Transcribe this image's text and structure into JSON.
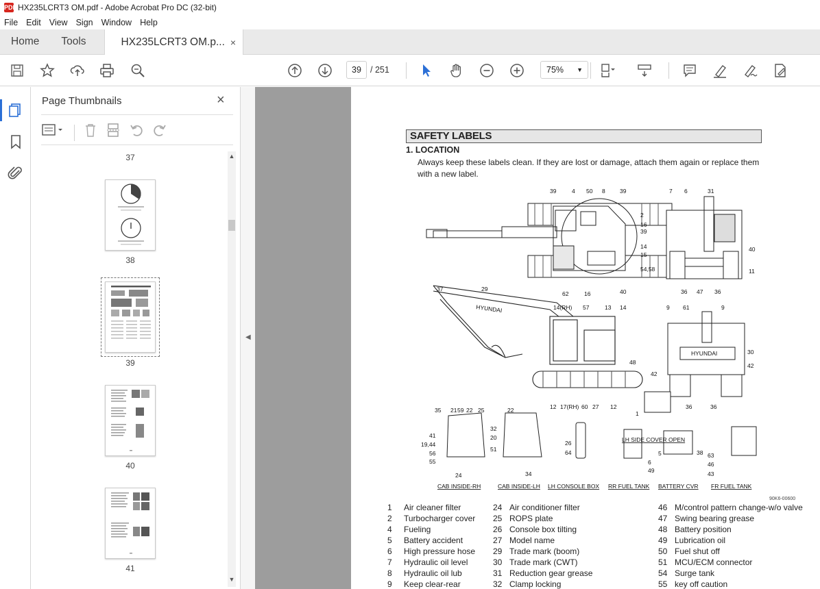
{
  "window": {
    "title": "HX235LCRT3 OM.pdf - Adobe Acrobat Pro DC (32-bit)",
    "app_icon": "PDF"
  },
  "menu": [
    "File",
    "Edit",
    "View",
    "Sign",
    "Window",
    "Help"
  ],
  "tabs": {
    "home": "Home",
    "tools": "Tools",
    "document": "HX235LCRT3 OM.p...",
    "close": "×"
  },
  "toolbar": {
    "current_page": "39",
    "page_total": "/ 251",
    "zoom": "75%",
    "icons": [
      "save-icon",
      "bookmark-star-icon",
      "upload-icon",
      "print-icon",
      "search-zoom-icon",
      "page-up-icon",
      "page-down-icon",
      "select-arrow-icon",
      "hand-icon",
      "zoom-out-icon",
      "zoom-in-icon",
      "fit-page-icon",
      "scroll-mode-icon",
      "comment-icon",
      "highlight-icon",
      "sign-icon",
      "edit-pdf-icon"
    ]
  },
  "thumb_panel": {
    "title": "Page Thumbnails",
    "close": "×",
    "pages": [
      {
        "label": "37"
      },
      {
        "label": "38"
      },
      {
        "label": "39",
        "selected": true
      },
      {
        "label": "40"
      },
      {
        "label": "41"
      }
    ]
  },
  "document": {
    "section_header": "SAFETY LABELS",
    "subsection": "1.  LOCATION",
    "intro": "Always keep these labels clean.  If they are lost or damage, attach them again or replace them with a new label.",
    "figure_code": "90K6-00600",
    "diagram_labels": {
      "top_view": [
        "39",
        "4",
        "50",
        "8",
        "39",
        "2",
        "16",
        "39",
        "14",
        "15",
        "54,58",
        "40",
        "16",
        "62"
      ],
      "rear_view": [
        "7",
        "6",
        "31",
        "40",
        "11",
        "36",
        "47",
        "36"
      ],
      "side_view": [
        "37",
        "29",
        "14(RH)",
        "57",
        "13",
        "14",
        "48",
        "12",
        "17(RH)",
        "60",
        "27",
        "12"
      ],
      "front_view": [
        "9",
        "61",
        "9",
        "30",
        "42",
        "42",
        "36",
        "36"
      ],
      "cab_rh": [
        "35",
        "21",
        "59",
        "22",
        "25",
        "41",
        "19,44",
        "56",
        "55",
        "32",
        "20",
        "51",
        "24"
      ],
      "cab_lh": [
        "22",
        "34"
      ],
      "console": [
        "26",
        "64"
      ],
      "side_cover": [
        "1"
      ],
      "fuel": [
        "6",
        "49"
      ],
      "battery": [
        "5",
        "38"
      ],
      "fr_fuel": [
        "63",
        "46",
        "43"
      ]
    },
    "captions": [
      "CAB INSIDE-RH",
      "CAB INSIDE-LH",
      "LH CONSOLE BOX",
      "RR FUEL TANK",
      "BATTERY CVR",
      "FR FUEL TANK",
      "LH SIDE COVER OPEN"
    ],
    "diagram_brand": "HYUNDAI",
    "legend_col1": [
      [
        "1",
        "Air cleaner filter"
      ],
      [
        "2",
        "Turbocharger cover"
      ],
      [
        "4",
        "Fueling"
      ],
      [
        "5",
        "Battery accident"
      ],
      [
        "6",
        "High pressure hose"
      ],
      [
        "7",
        "Hydraulic oil level"
      ],
      [
        "8",
        "Hydraulic oil lub"
      ],
      [
        "9",
        "Keep clear-rear"
      ]
    ],
    "legend_col2": [
      [
        "24",
        "Air conditioner filter"
      ],
      [
        "25",
        "ROPS plate"
      ],
      [
        "26",
        "Console box tilting"
      ],
      [
        "27",
        "Model name"
      ],
      [
        "29",
        "Trade mark (boom)"
      ],
      [
        "30",
        "Trade mark (CWT)"
      ],
      [
        "31",
        "Reduction gear grease"
      ],
      [
        "32",
        "Clamp locking"
      ]
    ],
    "legend_col3": [
      [
        "46",
        "M/control pattern change-w/o valve"
      ],
      [
        "47",
        "Swing bearing grease"
      ],
      [
        "48",
        "Battery position"
      ],
      [
        "49",
        "Lubrication oil"
      ],
      [
        "50",
        "Fuel shut off"
      ],
      [
        "51",
        "MCU/ECM connector"
      ],
      [
        "54",
        "Surge tank"
      ],
      [
        "55",
        "key off caution"
      ]
    ]
  }
}
